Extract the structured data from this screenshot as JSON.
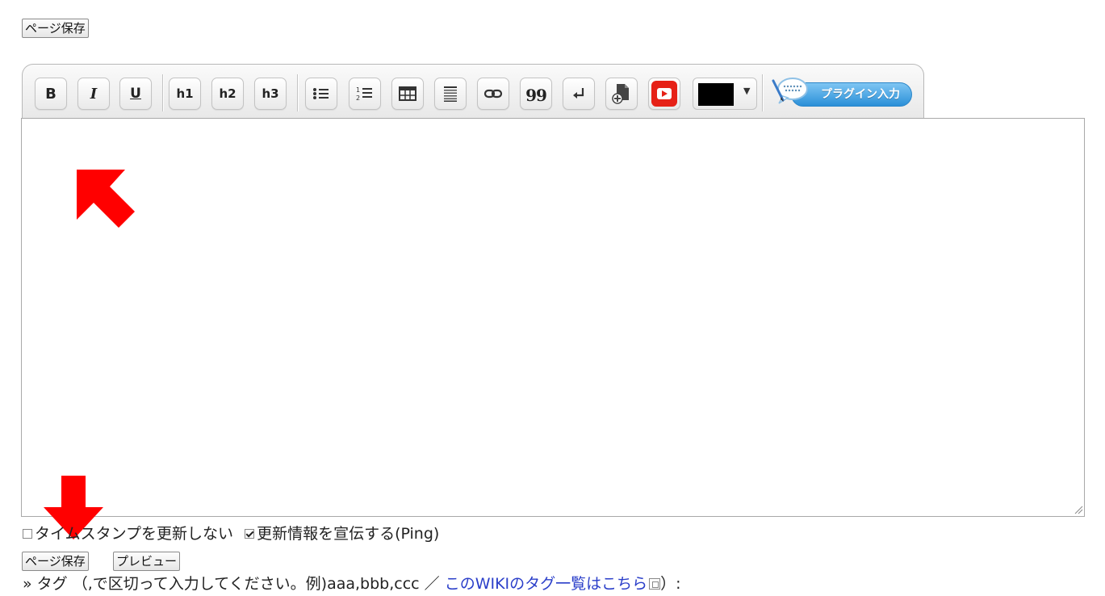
{
  "top_save_label": "ページ保存",
  "toolbar": {
    "bold_label": "B",
    "italic_label": "I",
    "underline_label": "U",
    "h1_label": "h1",
    "h2_label": "h2",
    "h3_label": "h3",
    "quote_label": "99",
    "plugin_label": "プラグイン入力",
    "selected_color": "#000000",
    "icons": [
      "bulleted-list-icon",
      "numbered-list-icon",
      "table-icon",
      "align-icon",
      "link-icon",
      "quote-icon",
      "line-break-icon",
      "attach-file-icon",
      "youtube-icon",
      "color-dropdown-icon",
      "plugin-icon"
    ]
  },
  "editor": {
    "value": ""
  },
  "options": {
    "no_timestamp_label": "タイムスタンプを更新しない",
    "no_timestamp_checked": false,
    "ping_label": "更新情報を宣伝する(Ping)",
    "ping_checked": true
  },
  "buttons": {
    "save_label": "ページ保存",
    "preview_label": "プレビュー"
  },
  "tags": {
    "prefix": "» タグ （,で区切って入力してください。例)aaa,bbb,ccc ／ ",
    "link_text": "このWIKIのタグ一覧はこちら",
    "suffix": "）:"
  },
  "annotation_color": "#ff0000",
  "youtube_color": "#e62117",
  "plugin_color": "#2a8fd8"
}
